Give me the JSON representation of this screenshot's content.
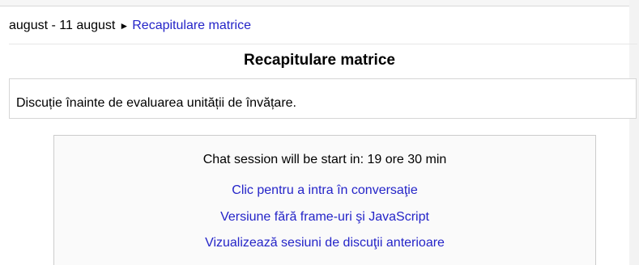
{
  "breadcrumb": {
    "date_range": "august - 11 august",
    "separator": "►",
    "current_link": "Recapitulare matrice"
  },
  "page": {
    "title": "Recapitulare matrice"
  },
  "intro": {
    "text": "Discuție înainte de evaluarea unității de învățare."
  },
  "chat": {
    "status": "Chat session will be start in: 19 ore 30 min",
    "enter_link": "Clic pentru a intra în conversaţie",
    "noframes_link": "Versiune fără frame-uri şi JavaScript",
    "past_sessions_link": "Vizualizează sesiuni de discuţii anterioare"
  },
  "colors": {
    "link": "#2424c8",
    "text": "#000000",
    "box_border": "#cccccc"
  }
}
